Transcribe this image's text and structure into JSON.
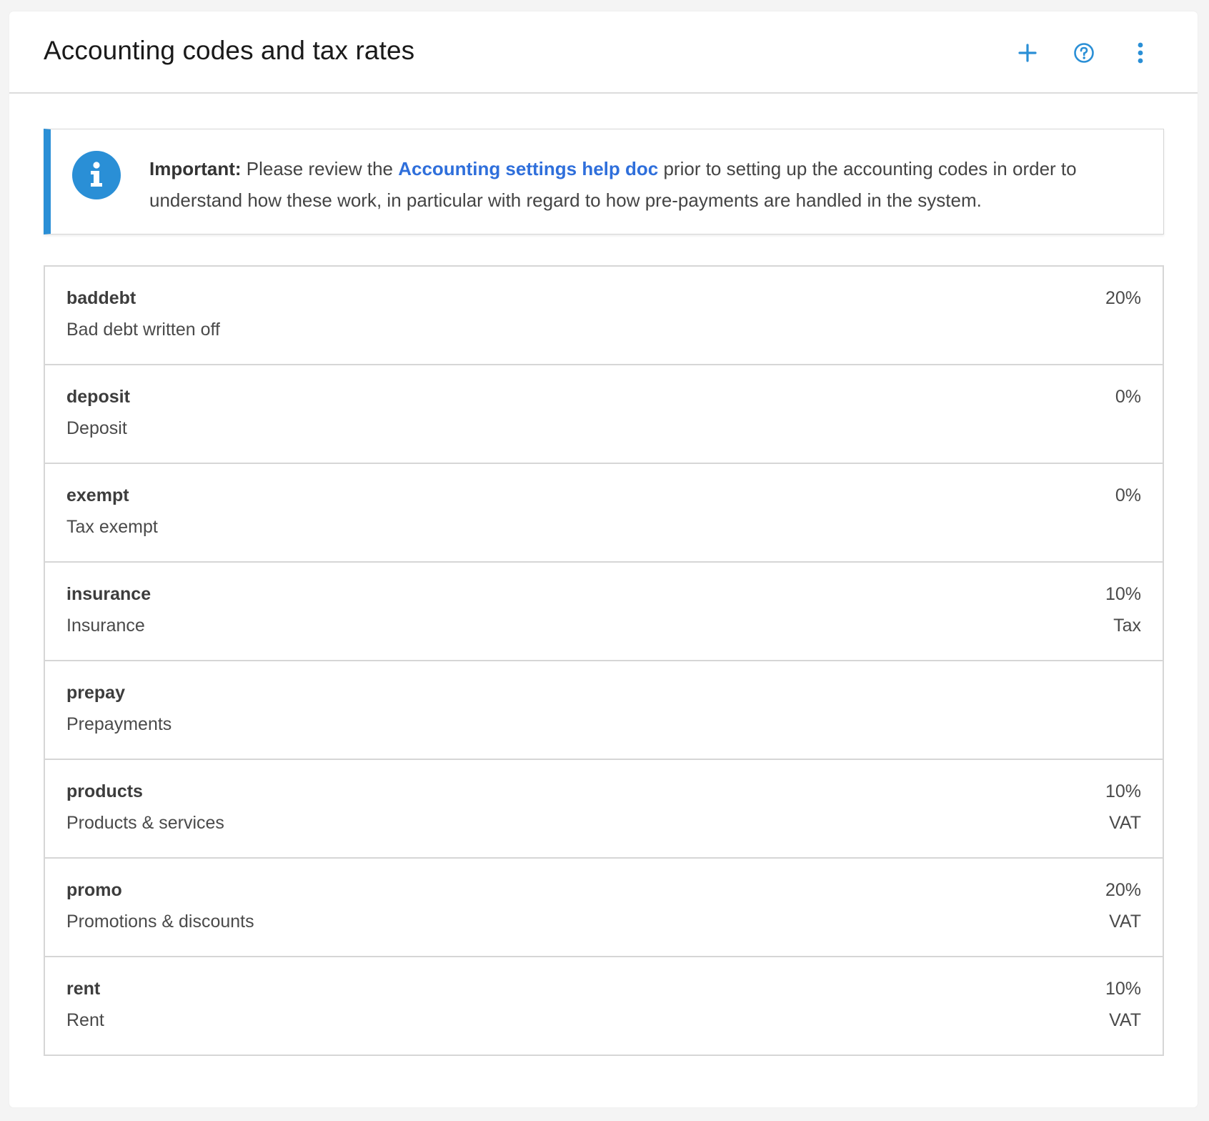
{
  "header": {
    "title": "Accounting codes and tax rates",
    "actions": [
      {
        "name": "add",
        "icon": "plus-icon"
      },
      {
        "name": "help",
        "icon": "question-circle-icon"
      },
      {
        "name": "more",
        "icon": "vertical-dots-icon"
      }
    ]
  },
  "notice": {
    "icon": "info-icon",
    "label": "Important:",
    "text_before": " Please review the ",
    "link_text": "Accounting settings help doc",
    "text_after": " prior to setting up the accounting codes in order to understand how these work, in particular with regard to how pre-payments are handled in the system."
  },
  "codes": [
    {
      "code": "baddebt",
      "description": "Bad debt written off",
      "rate": "20%",
      "type": ""
    },
    {
      "code": "deposit",
      "description": "Deposit",
      "rate": "0%",
      "type": ""
    },
    {
      "code": "exempt",
      "description": "Tax exempt",
      "rate": "0%",
      "type": ""
    },
    {
      "code": "insurance",
      "description": "Insurance",
      "rate": "10%",
      "type": "Tax"
    },
    {
      "code": "prepay",
      "description": "Prepayments",
      "rate": "",
      "type": ""
    },
    {
      "code": "products",
      "description": "Products & services",
      "rate": "10%",
      "type": "VAT"
    },
    {
      "code": "promo",
      "description": "Promotions & discounts",
      "rate": "20%",
      "type": "VAT"
    },
    {
      "code": "rent",
      "description": "Rent",
      "rate": "10%",
      "type": "VAT"
    }
  ],
  "colors": {
    "accent": "#2a8fd6",
    "link": "#2f6fdb",
    "background": "#f4f4f4"
  }
}
